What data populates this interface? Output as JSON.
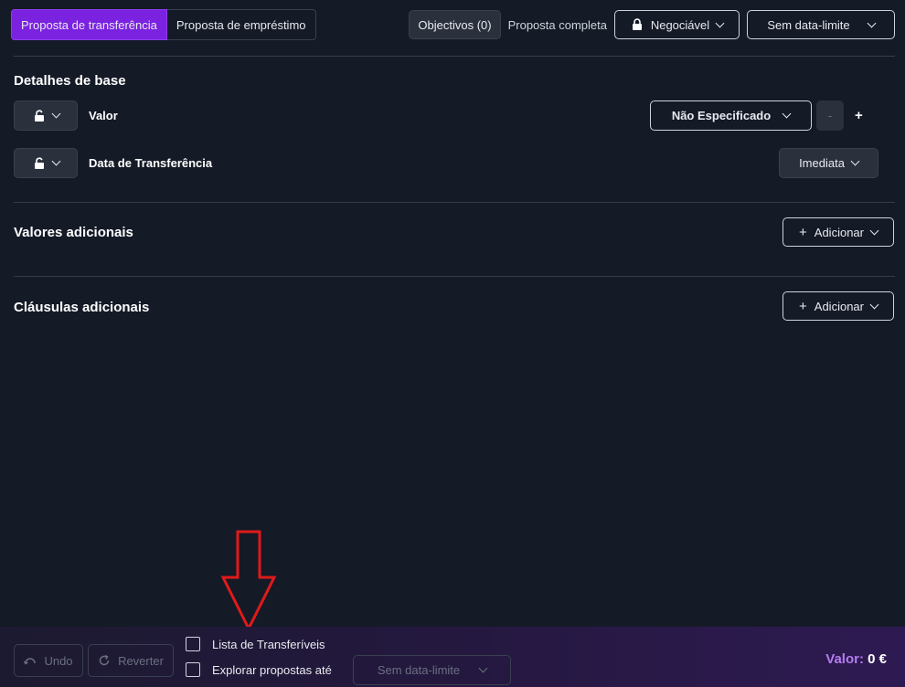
{
  "tabs": [
    {
      "label": "Proposta de transferência",
      "active": true
    },
    {
      "label": "Proposta de empréstimo",
      "active": false
    }
  ],
  "header": {
    "objectives_label": "Objectivos (0)",
    "complete_label": "Proposta completa",
    "negotiable_label": "Negociável",
    "deadline_label": "Sem data-limite"
  },
  "basic": {
    "title": "Detalhes de base",
    "value_label": "Valor",
    "value_select": "Não Especificado",
    "minus": "-",
    "plus": "+",
    "date_label": "Data de Transferência",
    "date_select": "Imediata"
  },
  "additional_values": {
    "title": "Valores adicionais",
    "add_label": "Adicionar"
  },
  "additional_clauses": {
    "title": "Cláusulas adicionais",
    "add_label": "Adicionar"
  },
  "footer": {
    "undo_label": "Undo",
    "revert_label": "Reverter",
    "transfer_list_label": "Lista de Transferíveis",
    "explore_label": "Explorar propostas até",
    "explore_deadline": "Sem data-limite",
    "total_label": "Valor:",
    "total_value": "0 €"
  },
  "colors": {
    "accent": "#7b22e0",
    "background": "#141a26",
    "total_label": "#b57cf0",
    "annotation_arrow": "#e01a1a"
  }
}
